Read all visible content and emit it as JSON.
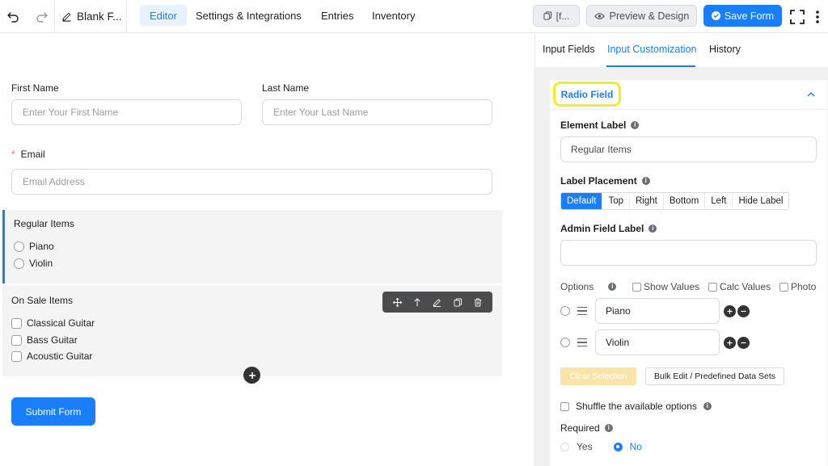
{
  "topbar": {
    "form_name": "Blank F...",
    "nav": [
      {
        "label": "Editor",
        "active": true
      },
      {
        "label": "Settings & Integrations",
        "active": false
      },
      {
        "label": "Entries",
        "active": false
      },
      {
        "label": "Inventory",
        "active": false
      }
    ],
    "shortcode_label": "[f...",
    "preview_label": "Preview & Design",
    "save_label": "Save Form",
    "icons": {
      "undo": "undo-icon",
      "redo": "redo-icon",
      "edit": "pencil-icon",
      "shortcode": "copy-icon",
      "preview": "eye-icon",
      "save": "check-circle-icon",
      "fullscreen": "fullscreen-icon",
      "more": "more-vertical-icon"
    }
  },
  "form": {
    "first_name": {
      "label": "First Name",
      "placeholder": "Enter Your First Name"
    },
    "last_name": {
      "label": "Last Name",
      "placeholder": "Enter Your Last Name"
    },
    "email": {
      "required_mark": "*",
      "label": "Email",
      "placeholder": "Email Address"
    },
    "regular_items": {
      "label": "Regular Items",
      "options": [
        "Piano",
        "Violin"
      ]
    },
    "on_sale_items": {
      "label": "On Sale Items",
      "options": [
        "Classical Guitar",
        "Bass Guitar",
        "Acoustic Guitar"
      ]
    },
    "submit_label": "Submit Form"
  },
  "panel": {
    "tabs": [
      {
        "label": "Input Fields",
        "active": false
      },
      {
        "label": "Input Customization",
        "active": true
      },
      {
        "label": "History",
        "active": false
      }
    ],
    "section_title": "Radio Field",
    "element_label": {
      "label": "Element Label",
      "value": "Regular Items"
    },
    "label_placement": {
      "label": "Label Placement",
      "options": [
        "Default",
        "Top",
        "Right",
        "Bottom",
        "Left",
        "Hide Label"
      ],
      "selected": "Default"
    },
    "admin_field_label": {
      "label": "Admin Field Label",
      "value": ""
    },
    "options": {
      "label": "Options",
      "show_values": "Show Values",
      "calc_values": "Calc Values",
      "photo": "Photo",
      "items": [
        "Piano",
        "Violin"
      ]
    },
    "clear_selection": "Clear Selection",
    "bulk_edit": "Bulk Edit / Predefined Data Sets",
    "shuffle_label": "Shuffle the available options",
    "required": {
      "label": "Required",
      "yes": "Yes",
      "no": "No",
      "selected": "No"
    }
  },
  "colors": {
    "accent": "#1a7efb",
    "highlight": "#f3ee1d",
    "required": "#f56c6c"
  }
}
